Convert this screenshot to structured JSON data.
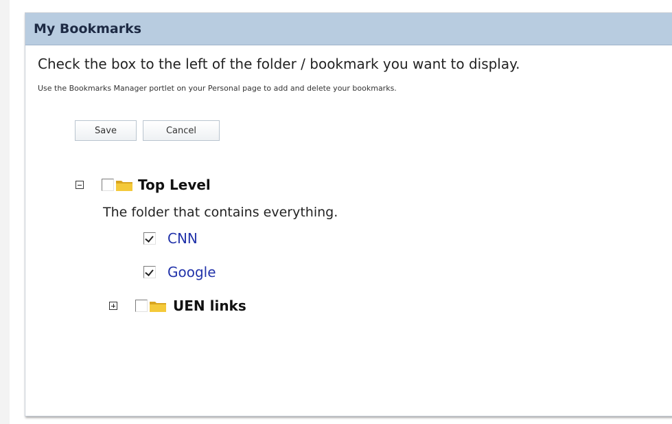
{
  "portlet": {
    "title": "My Bookmarks",
    "instructions": "Check the box to the left of the folder / bookmark you want to display.",
    "sub_instructions": "Use the Bookmarks Manager portlet on your Personal page to add and delete your bookmarks."
  },
  "buttons": {
    "save": "Save",
    "cancel": "Cancel"
  },
  "tree": {
    "top_level": {
      "label": "Top Level",
      "description": "The folder that contains everything.",
      "expanded": true,
      "checked": false
    },
    "bookmarks": [
      {
        "label": "CNN",
        "checked": true
      },
      {
        "label": "Google",
        "checked": true
      }
    ],
    "subfolder": {
      "label": "UEN links",
      "expanded": false,
      "checked": false
    }
  },
  "icons": {
    "collapse": "minus-box-icon",
    "expand": "plus-box-icon",
    "folder": "folder-icon"
  },
  "colors": {
    "header_bg": "#b8cce0",
    "link": "#2233aa",
    "folder": "#f2c230"
  }
}
